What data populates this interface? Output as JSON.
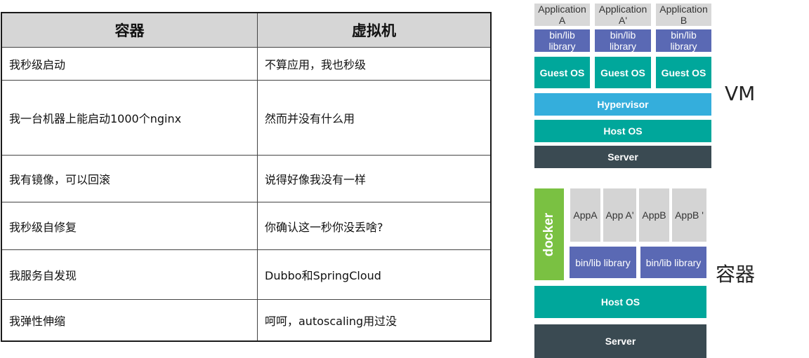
{
  "table": {
    "headers": [
      "容器",
      "虚拟机"
    ],
    "rows": [
      [
        "我秒级启动",
        "不算应用，我也秒级"
      ],
      [
        "我一台机器上能启动1000个nginx",
        "然而并没有什么用"
      ],
      [
        "我有镜像，可以回滚",
        "说得好像我没有一样"
      ],
      [
        "我秒级自修复",
        "你确认这一秒你没丢啥?"
      ],
      [
        "我服务自发现",
        "Dubbo和SpringCloud"
      ],
      [
        "我弹性伸缩",
        "呵呵，autoscaling用过没"
      ]
    ]
  },
  "vm": {
    "label": "VM",
    "apps": [
      {
        "line1": "Application",
        "line2": "A"
      },
      {
        "line1": "Application",
        "line2": "A'"
      },
      {
        "line1": "Application",
        "line2": "B"
      }
    ],
    "libs": [
      {
        "line1": "bin/lib",
        "line2": "library"
      },
      {
        "line1": "bin/lib",
        "line2": "library"
      },
      {
        "line1": "bin/lib",
        "line2": "library"
      }
    ],
    "guest_os": [
      "Guest OS",
      "Guest OS",
      "Guest OS"
    ],
    "hypervisor": "Hypervisor",
    "host_os": "Host OS",
    "server": "Server"
  },
  "container": {
    "label": "容器",
    "docker": "docker",
    "apps": [
      "AppA",
      "App A'",
      "AppB",
      "AppB '"
    ],
    "libs": [
      "bin/lib library",
      "bin/lib library"
    ],
    "host_os": "Host OS",
    "server": "Server"
  },
  "colors": {
    "app_gray": "#d8d8d8",
    "lib_blue": "#5a69b4",
    "os_teal": "#00a79b",
    "hypervisor_blue": "#34aedc",
    "server_dark": "#3a4a52",
    "docker_green": "#7ac142"
  }
}
